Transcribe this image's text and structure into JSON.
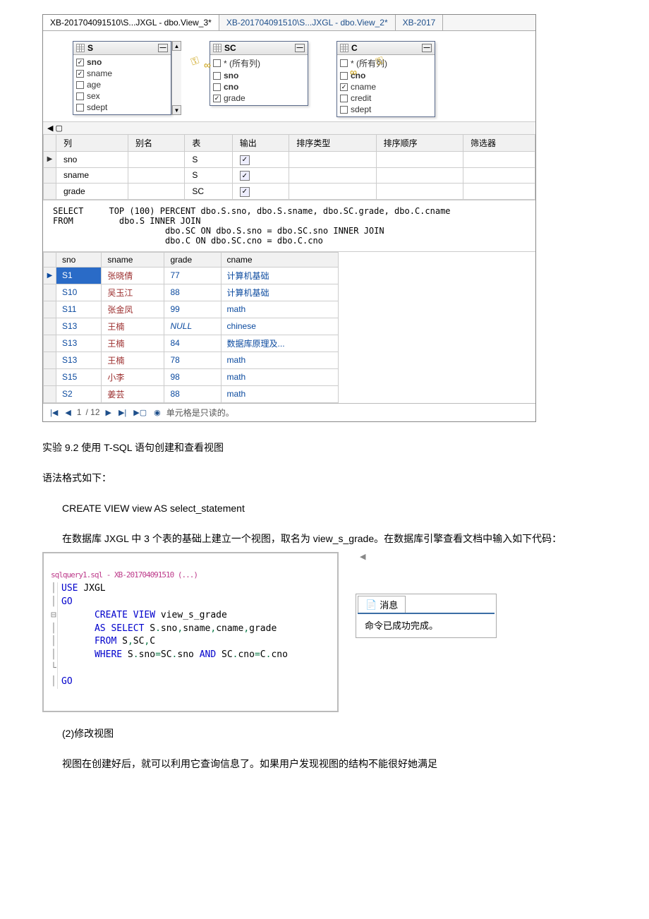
{
  "tabs": [
    {
      "label": "XB-201704091510\\S...JXGL - dbo.View_3*",
      "active": true
    },
    {
      "label": "XB-201704091510\\S...JXGL - dbo.View_2*",
      "active": false
    },
    {
      "label": "XB-2017",
      "active": false
    }
  ],
  "tables": {
    "S": {
      "title": "S",
      "cols": [
        {
          "name": "sno",
          "checked": true,
          "bold": true
        },
        {
          "name": "sname",
          "checked": true
        },
        {
          "name": "age",
          "checked": false
        },
        {
          "name": "sex",
          "checked": false
        },
        {
          "name": "sdept",
          "checked": false
        }
      ]
    },
    "SC": {
      "title": "SC",
      "cols": [
        {
          "name": "* (所有列)",
          "checked": false
        },
        {
          "name": "sno",
          "checked": false,
          "bold": true
        },
        {
          "name": "cno",
          "checked": false,
          "bold": true
        },
        {
          "name": "grade",
          "checked": true
        }
      ]
    },
    "C": {
      "title": "C",
      "cols": [
        {
          "name": "* (所有列)",
          "checked": false
        },
        {
          "name": "cno",
          "checked": false,
          "bold": true
        },
        {
          "name": "cname",
          "checked": true
        },
        {
          "name": "credit",
          "checked": false
        },
        {
          "name": "sdept",
          "checked": false
        }
      ]
    }
  },
  "design_headers": [
    "列",
    "别名",
    "表",
    "输出",
    "排序类型",
    "排序顺序",
    "筛选器"
  ],
  "design_rows": [
    {
      "col": "sno",
      "alias": "",
      "table": "S",
      "output": true
    },
    {
      "col": "sname",
      "alias": "",
      "table": "S",
      "output": true
    },
    {
      "col": "grade",
      "alias": "",
      "table": "SC",
      "output": true
    }
  ],
  "sql_text": "SELECT     TOP (100) PERCENT dbo.S.sno, dbo.S.sname, dbo.SC.grade, dbo.C.cname\nFROM         dbo.S INNER JOIN\n                      dbo.SC ON dbo.S.sno = dbo.SC.sno INNER JOIN\n                      dbo.C ON dbo.SC.cno = dbo.C.cno",
  "result_headers": [
    "sno",
    "sname",
    "grade",
    "cname"
  ],
  "result_rows": [
    {
      "sno": "S1",
      "sname": "张晓倩",
      "grade": "77",
      "cname": "计算机基础"
    },
    {
      "sno": "S10",
      "sname": "吴玉江",
      "grade": "88",
      "cname": "计算机基础"
    },
    {
      "sno": "S11",
      "sname": "张金凤",
      "grade": "99",
      "cname": "math"
    },
    {
      "sno": "S13",
      "sname": "王楠",
      "grade": "NULL",
      "cname": "chinese"
    },
    {
      "sno": "S13",
      "sname": "王楠",
      "grade": "84",
      "cname": "数据库原理及..."
    },
    {
      "sno": "S13",
      "sname": "王楠",
      "grade": "78",
      "cname": "math"
    },
    {
      "sno": "S15",
      "sname": "小李",
      "grade": "98",
      "cname": "math"
    },
    {
      "sno": "S2",
      "sname": "姜芸",
      "grade": "88",
      "cname": "math"
    }
  ],
  "record_nav": {
    "current": "1",
    "total": "/ 12",
    "status": "单元格是只读的。"
  },
  "doc": {
    "p1": "实验 9.2  使用 T-SQL 语句创建和查看视图",
    "p2": "语法格式如下：",
    "p3": "CREATE VIEW view AS select_statement",
    "p4": "在数据库 JXGL 中 3 个表的基础上建立一个视图，取名为 view_s_grade。在数据库引擎查看文档中输入如下代码：",
    "p5": "(2)修改视图",
    "p6": "视图在创建好后，就可以利用它查询信息了。如果用户发现视图的结构不能很好她满足"
  },
  "code": {
    "l0": "sqlquery1.sql - XB-201704091510 (...)",
    "l1": "USE JXGL",
    "l2": "GO",
    "l3": "      CREATE VIEW view_s_grade",
    "l4": "      AS SELECT S.sno,sname,cname,grade",
    "l5": "      FROM S,SC,C",
    "l6": "      WHERE S.sno=SC.sno AND SC.cno=C.cno",
    "l7": " ",
    "l8": "GO"
  },
  "msg": {
    "tab": "消息",
    "body": "命令已成功完成。"
  }
}
